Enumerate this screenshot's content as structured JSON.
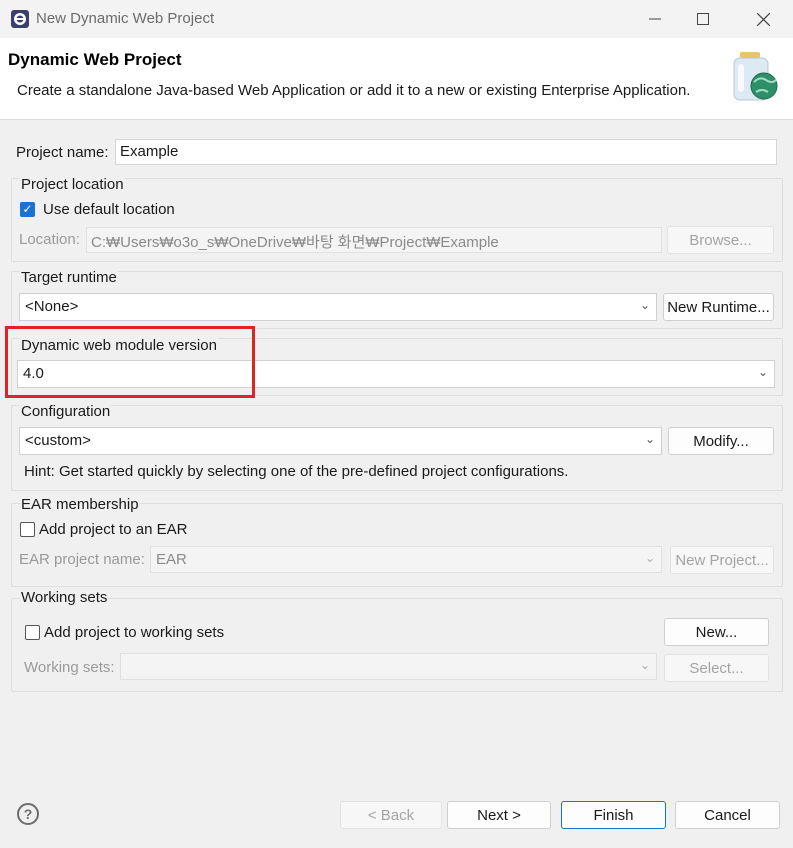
{
  "window": {
    "title": "New Dynamic Web Project"
  },
  "header": {
    "title": "Dynamic Web Project",
    "description": "Create a standalone Java-based Web Application or add it to a new or existing Enterprise Application."
  },
  "project_name": {
    "label": "Project name:",
    "value": "Example"
  },
  "project_location": {
    "group_label": "Project location",
    "use_default_label": "Use default location",
    "use_default_checked": true,
    "location_label": "Location:",
    "location_value": "C:₩Users₩o3o_s₩OneDrive₩바탕 화면₩Project₩Example",
    "browse_label": "Browse..."
  },
  "target_runtime": {
    "group_label": "Target runtime",
    "selected": "<None>",
    "new_runtime_label": "New Runtime..."
  },
  "module_version": {
    "group_label": "Dynamic web module version",
    "selected": "4.0"
  },
  "configuration": {
    "group_label": "Configuration",
    "selected": "<custom>",
    "modify_label": "Modify...",
    "hint": "Hint: Get started quickly by selecting one of the pre-defined project configurations."
  },
  "ear": {
    "group_label": "EAR membership",
    "add_label": "Add project to an EAR",
    "add_checked": false,
    "project_name_label": "EAR project name:",
    "project_name_value": "EAR",
    "new_project_label": "New Project..."
  },
  "working_sets": {
    "group_label": "Working sets",
    "add_label": "Add project to working sets",
    "add_checked": false,
    "new_label": "New...",
    "sets_label": "Working sets:",
    "select_label": "Select..."
  },
  "footer": {
    "help_glyph": "?",
    "back_label": "< Back",
    "next_label": "Next >",
    "finish_label": "Finish",
    "cancel_label": "Cancel"
  },
  "icons": {
    "app": "eclipse-icon",
    "banner": "web-project-jar-globe-icon",
    "help": "help-icon",
    "dropdown": "chevron-down-icon"
  },
  "colors": {
    "highlight": "#e02323",
    "checkbox_checked": "#1a73d1",
    "primary_button_border": "#1a73c4"
  }
}
